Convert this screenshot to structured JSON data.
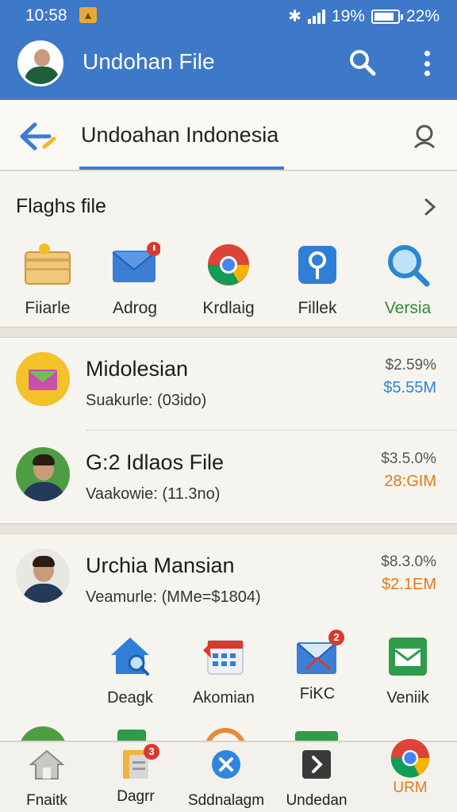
{
  "status_bar": {
    "time": "10:58",
    "battery_text": "19%",
    "battery_pct": "22%"
  },
  "header": {
    "title": "Undohan File"
  },
  "search": {
    "title": "Undoahan Indonesia"
  },
  "section": {
    "title": "Flaghs file"
  },
  "quick_actions": [
    {
      "label": "Fiiarle",
      "icon": "folder-icon"
    },
    {
      "label": "Adrog",
      "icon": "mail-icon",
      "badge": ""
    },
    {
      "label": "Krdlaig",
      "icon": "chrome-icon"
    },
    {
      "label": "Fillek",
      "icon": "pin-icon"
    },
    {
      "label": "Versia",
      "icon": "magnifier-icon",
      "color": "#2e8b3a"
    }
  ],
  "files": [
    {
      "title": "Midolesian",
      "sub": "Suakurle: (03ido)",
      "pct": "$2.59%",
      "amount": "$5.55M",
      "amount_color": "#2a86d8",
      "avatar": "envelope-icon"
    },
    {
      "title": "G:2 Idlaos File",
      "sub": "Vaakowie: (11.3no)",
      "pct": "$3.5.0%",
      "amount": "28:GIM",
      "amount_color": "#e07b1a",
      "avatar": "person-avatar"
    },
    {
      "title": "Urchia Mansian",
      "sub": "Veamurle: (MMe=$1804)",
      "pct": "$8.3.0%",
      "amount": "$2.1EM",
      "amount_color": "#e07b1a",
      "avatar": "person-avatar"
    }
  ],
  "apps": [
    {
      "label": "Deagk",
      "icon": "home-search-icon"
    },
    {
      "label": "Akomian",
      "icon": "calendar-icon"
    },
    {
      "label": "FiKC",
      "icon": "mail-icon",
      "badge": "2"
    },
    {
      "label": "Veniik",
      "icon": "green-mail-icon"
    }
  ],
  "bottom_nav": [
    {
      "label": "Fnaitk",
      "icon": "home-icon"
    },
    {
      "label": "Dagrr",
      "icon": "files-icon",
      "badge": "3"
    },
    {
      "label": "Sddnalagm",
      "icon": "close-circle-icon"
    },
    {
      "label": "Undedan",
      "icon": "forward-icon"
    },
    {
      "label": "URM",
      "icon": "chrome-icon",
      "color": "#e07b1a"
    }
  ]
}
